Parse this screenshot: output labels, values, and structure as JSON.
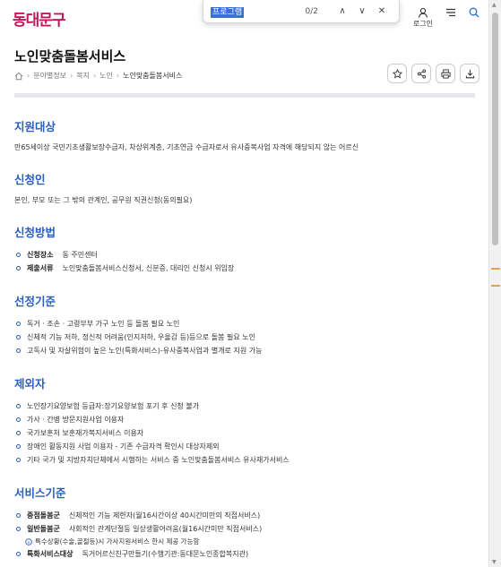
{
  "header": {
    "logo": "동대문구",
    "login_label": "로그인",
    "menu_icon": "hamburger-icon",
    "search_icon": "search-icon"
  },
  "findbar": {
    "query": "프로그램",
    "count": "0/2",
    "prev": "∧",
    "next": "∨",
    "close": "✕"
  },
  "page": {
    "title": "노인맞춤돌봄서비스",
    "breadcrumb": [
      "분야별정보",
      "복지",
      "노인",
      "노인맞춤돌봄서비스"
    ]
  },
  "sections": {
    "target": {
      "title": "지원대상",
      "text": "만65세이상 국민기초생활보장수급자, 차상위계층, 기초연금 수급자로서 유사중복사업 자격에 해당되지 않는 어르신"
    },
    "applicant": {
      "title": "신청인",
      "text": "본인, 부모 또는 그 밖의 관계인, 공무원 직권신청(동의필요)"
    },
    "method": {
      "title": "신청방법",
      "items": [
        {
          "k": "신청장소",
          "v": "동 주민센터"
        },
        {
          "k": "제출서류",
          "v": "노인맞춤돌봄서비스신청서, 신분증, 대리인 신청시 위임장"
        }
      ]
    },
    "criteria": {
      "title": "선정기준",
      "items": [
        "독거 · 조손 · 고령부부 가구 노인 등 돌봄 필요 노인",
        "신체적 기능 저하, 정신적 어려움(인지저하, 우울감 등)등으로 돌봄 필요 노인",
        "고독사 및 자살위험이 높은 노인(특화서비스)-유사중복사업과 별개로 지원 가능"
      ]
    },
    "excluded": {
      "title": "제외자",
      "items": [
        "노인장기요양보험 등급자:장기요양보험 포기 후 신청 불가",
        "가사 · 간병 방문지원사업 이용자",
        "국가보훈처 보훈재가복지서비스 이용자",
        "장애인 활동지원 사업 이용자 - 기존 수급자격 확인시 대상자제외",
        "기타 국가 및 지방자치단체에서 시행하는 서비스 중 노인맞춤돌봄서비스 유사재가서비스"
      ]
    },
    "service": {
      "title": "서비스기준",
      "items": [
        {
          "k": "중점돌봄군",
          "v": "신체적인 기능 제한자(월16시간이상 40시간미만의 직접서비스)"
        },
        {
          "k": "일반돌봄군",
          "v": "사회적인 관계단절등 일상생활어려움(월16시간미만 직접서비스)"
        },
        {
          "k": "특화서비스대상",
          "v": "독거어르신친구만들기(수행기관:동대문노인종합복지관)"
        }
      ],
      "note": "특수상황(수술,골절등)시 가사지원서비스 한시 제공 가능함"
    }
  }
}
